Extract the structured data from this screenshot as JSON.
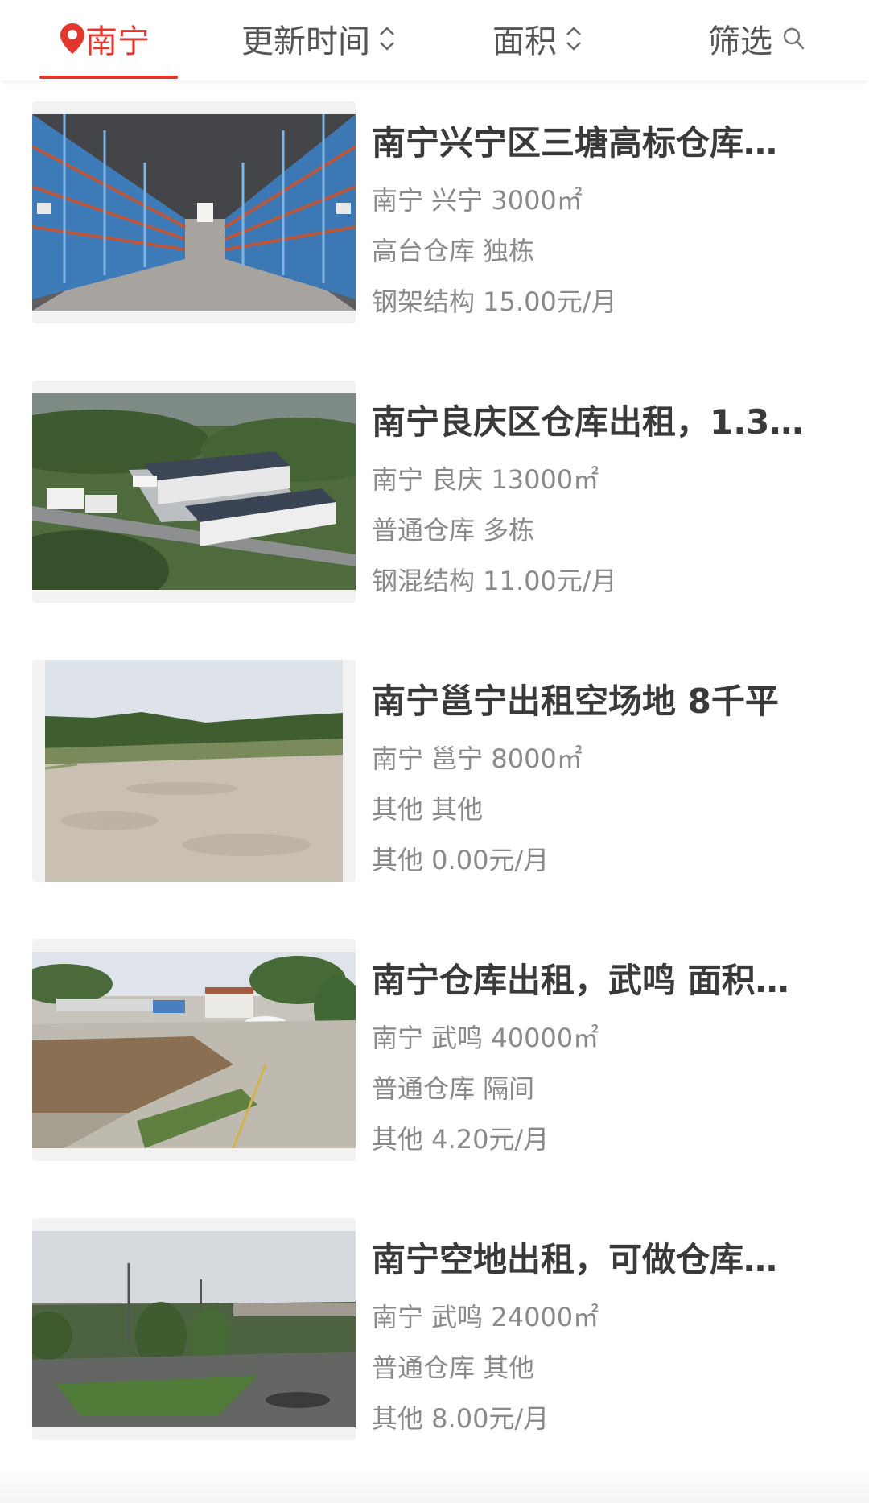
{
  "header": {
    "city": "南宁",
    "sort_update": "更新时间",
    "sort_area": "面积",
    "filter": "筛选"
  },
  "colors": {
    "accent": "#e3372e",
    "title": "#3a3a3a",
    "meta": "#8a8a8a"
  },
  "listings": [
    {
      "title": "南宁兴宁区三塘高标仓库…",
      "location_area": "南宁 兴宁 3000㎡",
      "type": "高台仓库 独栋",
      "structure_price": "钢架结构 15.00元/月",
      "image": "warehouse-racks-photo"
    },
    {
      "title": "南宁良庆区仓库出租，1.3…",
      "location_area": "南宁 良庆 13000㎡",
      "type": "普通仓库 多栋",
      "structure_price": "钢混结构 11.00元/月",
      "image": "warehouse-aerial-render"
    },
    {
      "title": "南宁邕宁出租空场地 8千平",
      "location_area": "南宁 邕宁 8000㎡",
      "type": "其他 其他",
      "structure_price": "其他 0.00元/月",
      "image": "empty-lot-photo"
    },
    {
      "title": "南宁仓库出租，武鸣 面积…",
      "location_area": "南宁 武鸣 40000㎡",
      "type": "普通仓库 隔间",
      "structure_price": "其他 4.20元/月",
      "image": "yard-buildings-photo"
    },
    {
      "title": "南宁空地出租，可做仓库…",
      "location_area": "南宁 武鸣 24000㎡",
      "type": "普通仓库 其他",
      "structure_price": "其他 8.00元/月",
      "image": "open-land-trees-photo"
    }
  ]
}
